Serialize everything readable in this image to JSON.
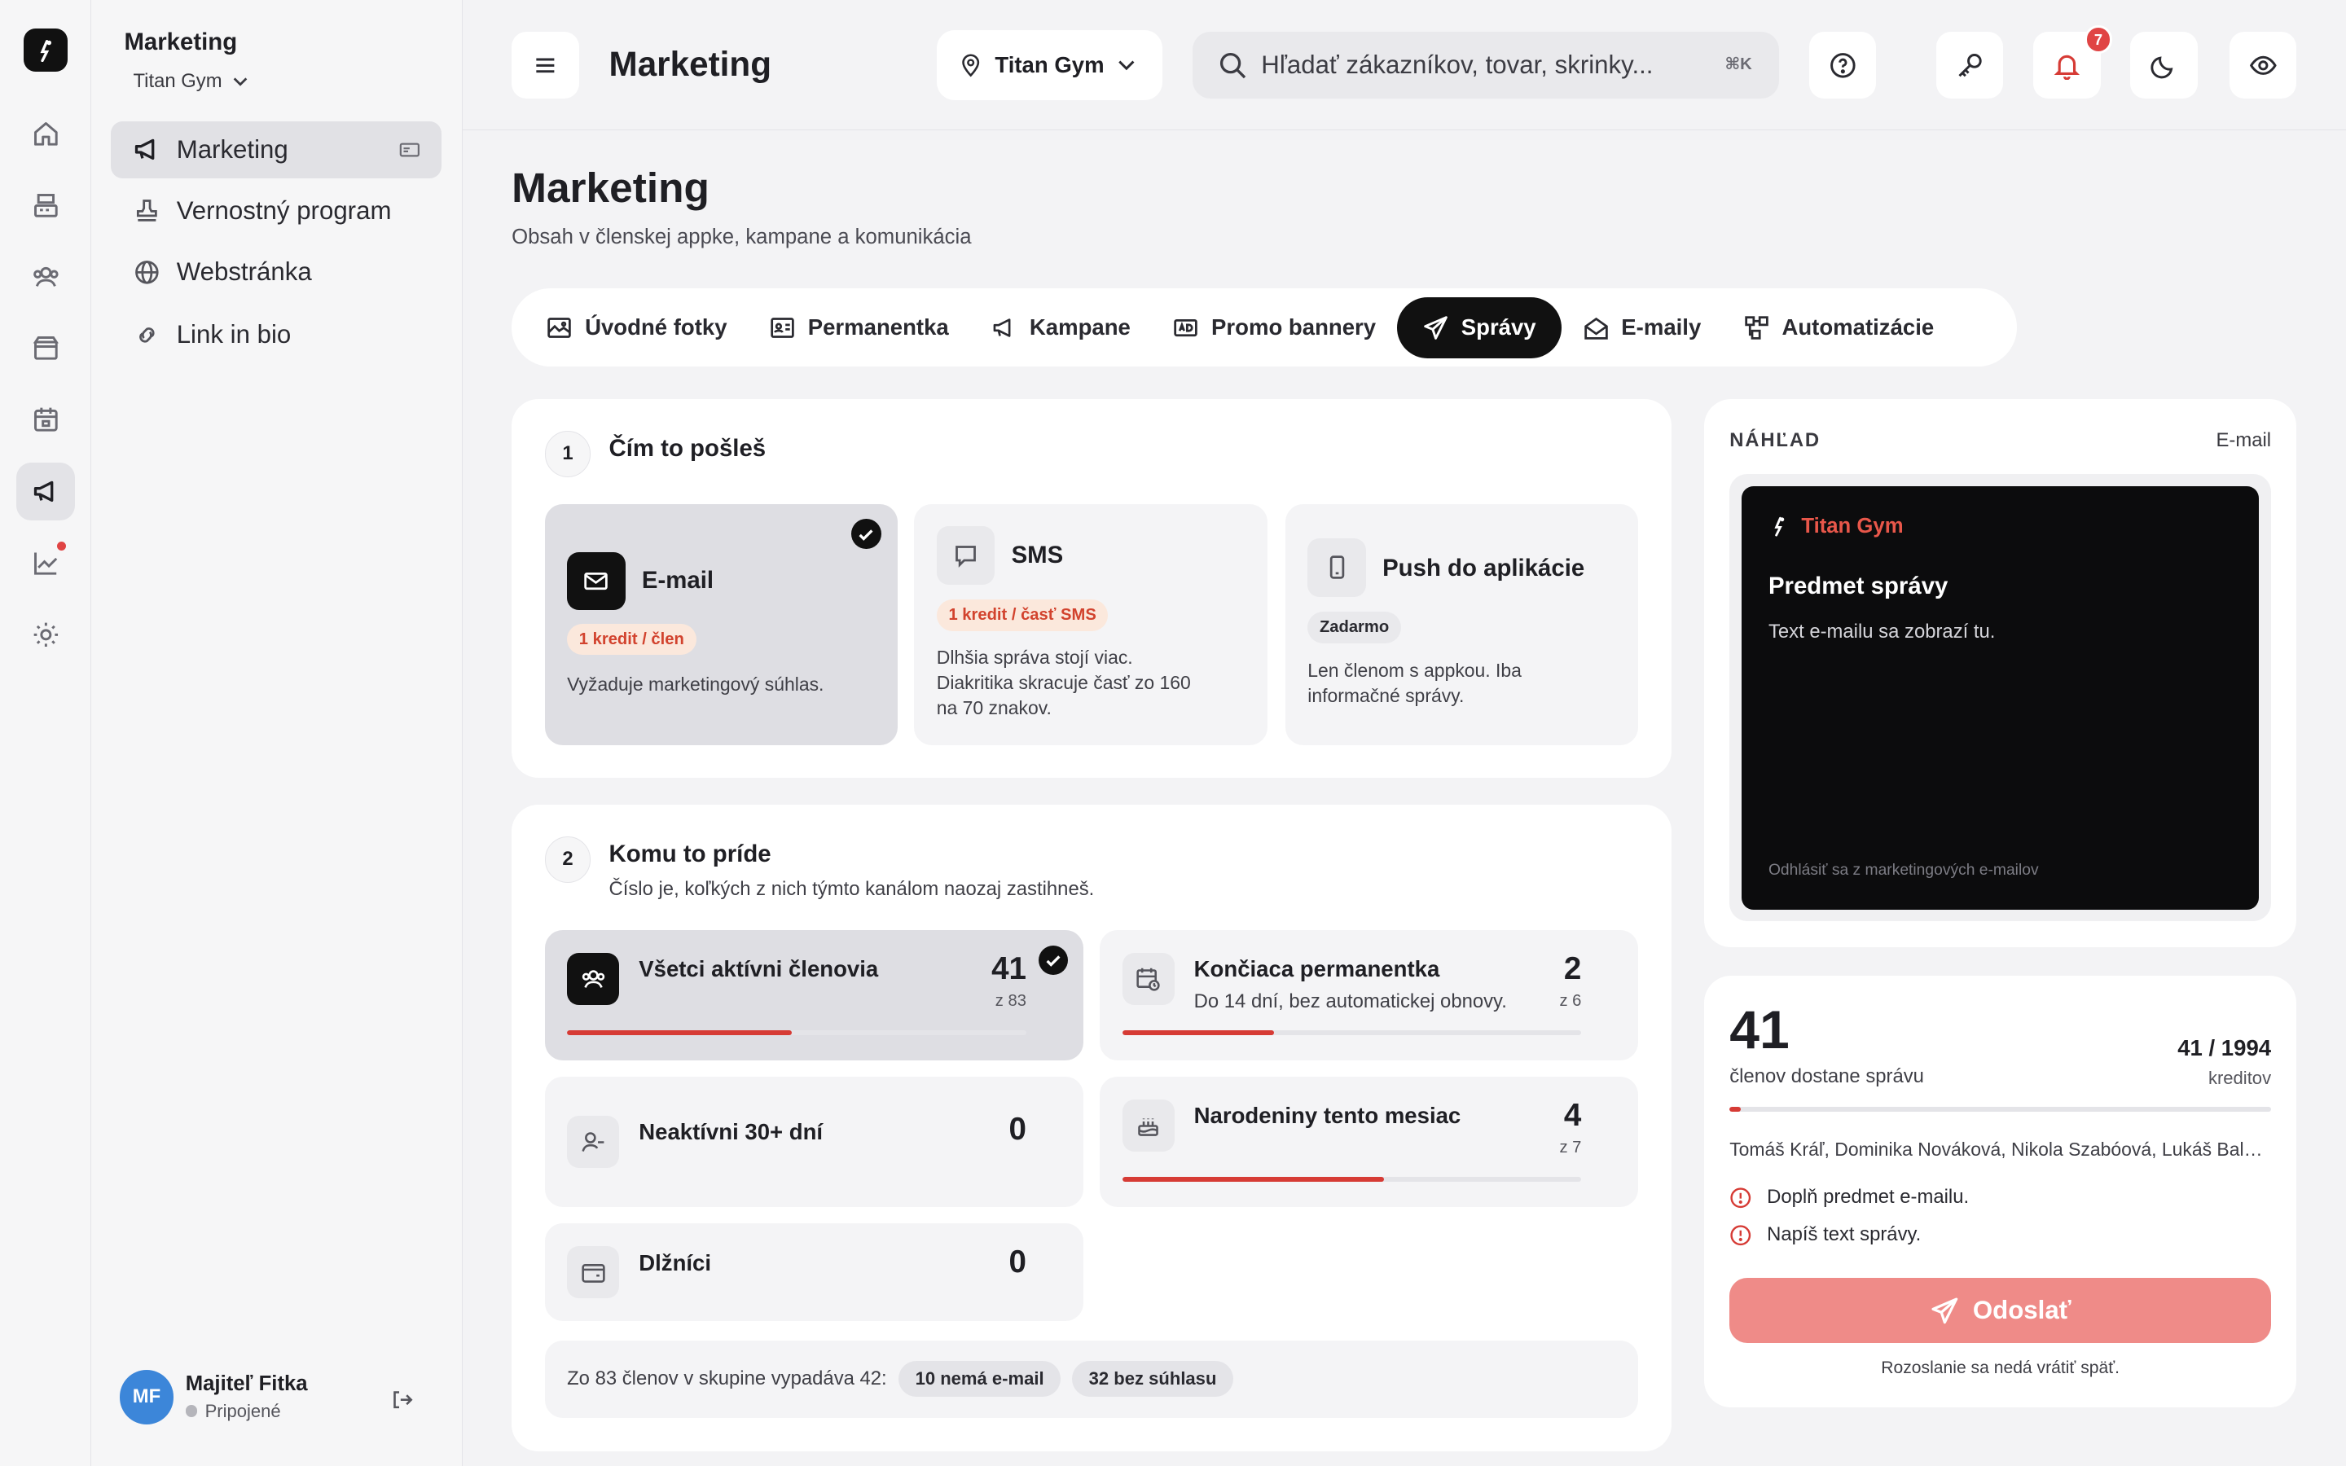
{
  "sidebar": {
    "title": "Marketing",
    "gym": "Titan Gym",
    "items": [
      {
        "label": "Marketing"
      },
      {
        "label": "Vernostný program"
      },
      {
        "label": "Webstránka"
      },
      {
        "label": "Link in bio"
      }
    ],
    "user": {
      "initials": "MF",
      "name": "Majiteľ Fitka",
      "status": "Pripojené"
    }
  },
  "topbar": {
    "title": "Marketing",
    "location": "Titan Gym",
    "search_placeholder": "Hľadať zákazníkov, tovar, skrinky...",
    "search_shortcut": "⌘K",
    "notifications_count": "7"
  },
  "page": {
    "title": "Marketing",
    "subtitle": "Obsah v členskej appke, kampane a komunikácia"
  },
  "tabs": [
    {
      "label": "Úvodné fotky"
    },
    {
      "label": "Permanentka"
    },
    {
      "label": "Kampane"
    },
    {
      "label": "Promo bannery"
    },
    {
      "label": "Správy",
      "active": true
    },
    {
      "label": "E-maily"
    },
    {
      "label": "Automatizácie"
    }
  ],
  "step1": {
    "number": "1",
    "title": "Čím to pošleš",
    "channels": [
      {
        "title": "E-mail",
        "price": "1 kredit / člen",
        "desc": "Vyžaduje marketingový súhlas.",
        "selected": true
      },
      {
        "title": "SMS",
        "price": "1 kredit / časť SMS",
        "desc1": "Dlhšia správa stojí viac.",
        "desc2": "Diakritika skracuje časť zo 160",
        "desc3": "na 70 znakov."
      },
      {
        "title": "Push do aplikácie",
        "price": "Zadarmo",
        "desc1": "Len členom s appkou. Iba",
        "desc2": "informačné správy."
      }
    ]
  },
  "step2": {
    "number": "2",
    "title": "Komu to príde",
    "subtitle": "Číslo je, koľkých z nich týmto kanálom naozaj zastihneš.",
    "audiences": [
      {
        "title": "Všetci aktívni členovia",
        "count": "41",
        "of": "z 83",
        "fill": 0.49,
        "selected": true
      },
      {
        "title": "Končiaca permanentka",
        "desc": "Do 14 dní, bez automatickej obnovy.",
        "count": "2",
        "of": "z 6",
        "fill": 0.33
      },
      {
        "title": "Neaktívni 30+ dní",
        "count": "0"
      },
      {
        "title": "Narodeniny tento mesiac",
        "count": "4",
        "of": "z 7",
        "fill": 0.57
      },
      {
        "title": "Dlžníci",
        "count": "0"
      }
    ],
    "footer": {
      "text": "Zo 83 členov v skupine vypadáva 42:",
      "chip1": "10 nemá e-mail",
      "chip2": "32 bez súhlasu"
    }
  },
  "preview": {
    "heading": "NÁHĽAD",
    "channel": "E-mail",
    "brand": "Titan Gym",
    "subject": "Predmet správy",
    "body": "Text e-mailu sa zobrazí tu.",
    "footer": "Odhlásiť sa z marketingových e-mailov"
  },
  "summary": {
    "count": "41",
    "count_label": "členov dostane správu",
    "credits": "41 / 1994",
    "credits_label": "kreditov",
    "credit_fill": 0.021,
    "recipients": "Tomáš Kráľ, Dominika Nováková, Nikola Szabóová, Lukáš Balogh",
    "warnings": [
      "Doplň predmet e-mailu.",
      "Napíš text správy."
    ],
    "send_label": "Odoslať",
    "note": "Rozoslanie sa nedá vrátiť späť."
  },
  "colors": {
    "accent": "#d63b35",
    "send": "#ef8b88",
    "avatar": "#3c86d9",
    "dark": "#111111"
  }
}
